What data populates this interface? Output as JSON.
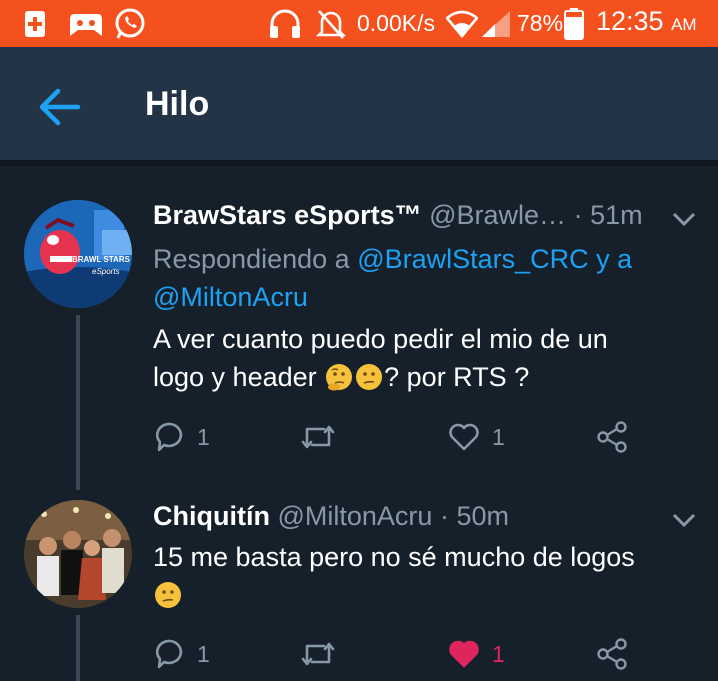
{
  "status_bar": {
    "speed": "0.00K/s",
    "battery": "78%",
    "time": "12:35",
    "ampm": "AM"
  },
  "app_bar": {
    "title": "Hilo"
  },
  "tweets": [
    {
      "name": "BrawStars eSports™",
      "handle": "@Brawle…",
      "time": "51m",
      "reply_prefix": "Respondiendo a",
      "reply_mention_1": "@BrawlStars_CRC",
      "reply_and": "y a",
      "reply_mention_2": "@MiltonAcru",
      "text_line1": "A ver cuanto puedo pedir el mio de un",
      "text_line2_a": "logo y header",
      "text_line2_b": "? por RTS ?",
      "replies": "1",
      "likes": "1",
      "avatar_text_1": "BRAWL STARS",
      "avatar_text_2": "eSports"
    },
    {
      "name": "Chiquitín",
      "handle": "@MiltonAcru",
      "time": "50m",
      "text_line1": "15 me basta pero no sé mucho de logos",
      "replies": "1",
      "likes": "1"
    }
  ],
  "colors": {
    "status_bar": "#f4511e",
    "app_bar": "#243447",
    "background": "#15202b",
    "accent": "#1da1f2",
    "like": "#e0245e"
  }
}
